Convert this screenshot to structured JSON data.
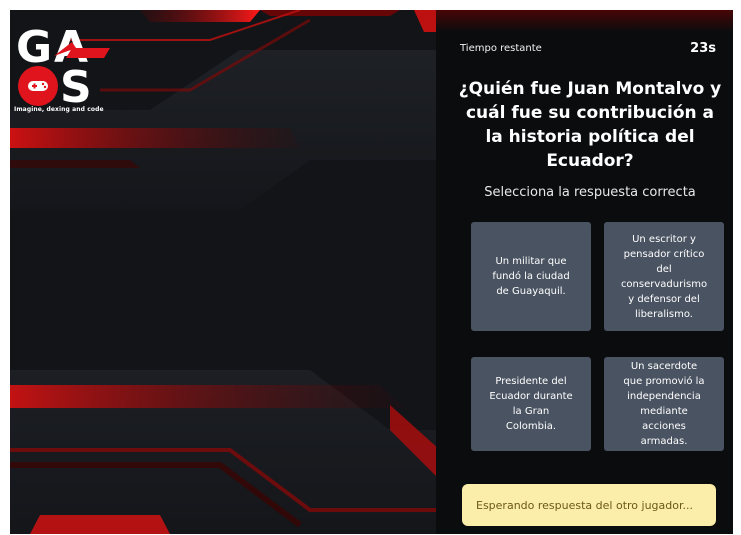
{
  "logo": {
    "tagline": "Imagine, dexing and code",
    "letters": [
      "G",
      "A",
      "S"
    ]
  },
  "timer": {
    "label": "Tiempo restante",
    "value": "23s"
  },
  "question": {
    "text": "¿Quién fue Juan Montalvo y cuál fue su contribución a la historia política del Ecuador?",
    "instruction": "Selecciona la respuesta correcta"
  },
  "options": [
    {
      "text": "Un militar que fundó la ciudad de Guayaquil."
    },
    {
      "text": "Un escritor y pensador crítico del conservadurismo y defensor del liberalismo."
    },
    {
      "text": "Presidente del Ecuador durante la Gran Colombia."
    },
    {
      "text": "Un sacerdote que promovió la independencia mediante acciones armadas."
    }
  ],
  "status": {
    "text": "Esperando respuesta del otro jugador..."
  },
  "colors": {
    "accent_red": "#e0141c",
    "panel_bg": "#0b0c0e",
    "option_bg": "#4a5361",
    "status_bg": "#fbeeaa",
    "status_text": "#6b5a16"
  }
}
